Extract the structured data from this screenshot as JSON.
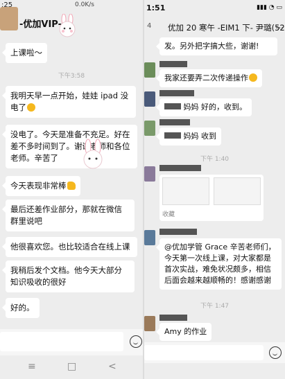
{
  "left": {
    "status": {
      "time": ":25",
      "network": "0.0K/s"
    },
    "title": "-优加VIP-",
    "messages": [
      "上课啦～",
      "我明天早一点开始，娃娃 ipad 没电了",
      "没电了。今天是准备不充足。好在差不多时间到了。谢谢老师和各位老师。辛苦了",
      "今天表现非常棒",
      "最后还差作业部分，那就在微信群里说吧",
      "他很喜欢您。也比较适合在线上课",
      "我稍后发个文档。他今天大部分知识吸收的很好",
      "好的。"
    ],
    "timestamp": "下午3:58"
  },
  "right": {
    "status": {
      "time": "1:51"
    },
    "header": {
      "badge": "4",
      "title": "优加 20 寒午 -EIM1 下- 尹璐(52)",
      "more": "..."
    },
    "top_partial": "发。另外把字搞大些，谢谢!",
    "messages": [
      {
        "text": "我家还要弄二次传递操作"
      },
      {
        "text": "妈妈 好的，收到。"
      },
      {
        "text": "妈妈 收到"
      }
    ],
    "time1": "下午 1:40",
    "favorite_label": "收藏",
    "announcement": "@优加学管 Grace 辛苦老师们，今天第一次线上课，对大家都是首次实战，难免状况颇多，相信后面会越来越顺畅的！感谢感谢",
    "time2": "下午 1:47",
    "last_message": "Amy 的作业"
  },
  "nav": {
    "menu": "≡",
    "home": "□",
    "back": "<"
  }
}
